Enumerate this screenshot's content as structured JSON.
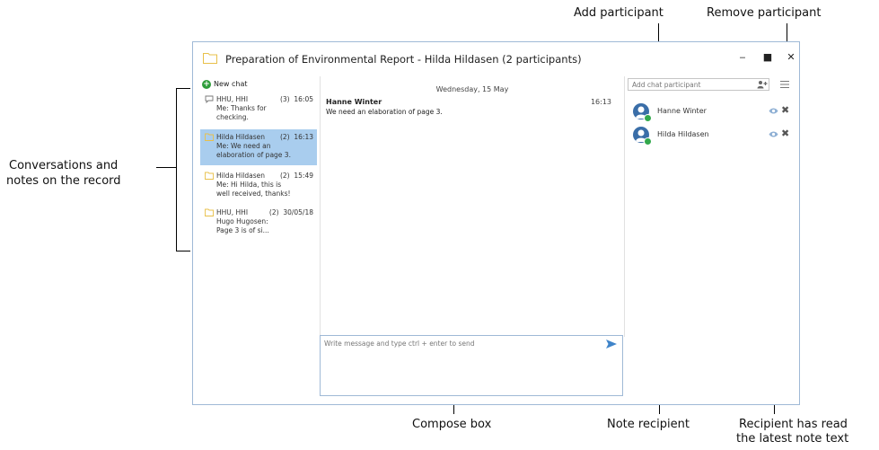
{
  "callouts": {
    "add_participant": "Add participant",
    "remove_participant": "Remove participant",
    "conversations_line1": "Conversations and",
    "conversations_line2": "notes on the record",
    "compose_box": "Compose box",
    "note_recipient": "Note recipient",
    "read_line1": "Recipient has read",
    "read_line2": "the latest note text"
  },
  "window": {
    "title": "Preparation of Environmental Report  - Hilda Hildasen (2 participants)",
    "minimize": "‒",
    "maximize": "■",
    "close": "✕"
  },
  "sidebar": {
    "new_chat": "New chat",
    "conversations": [
      {
        "name": "HHU, HHI",
        "count": "(3)",
        "time": "16:05",
        "line2": "Me: Thanks for",
        "line3": "checking.",
        "icon": "speech-bubble-icon",
        "selected": false
      },
      {
        "name": "Hilda Hildasen",
        "count": "(2)",
        "time": "16:13",
        "line2": "Me: We need an",
        "line3": "elaboration of page 3.",
        "icon": "folder-icon",
        "selected": true
      },
      {
        "name": "Hilda Hildasen",
        "count": "(2)",
        "time": "15:49",
        "line2": "Me: Hi Hilda, this is",
        "line3": "well received, thanks!",
        "icon": "folder-icon",
        "selected": false
      },
      {
        "name": "HHU, HHI",
        "count": "(2)",
        "time": "30/05/18",
        "line2": "Hugo Hugosen:",
        "line3": "Page 3 is of si...",
        "icon": "folder-icon",
        "selected": false
      }
    ]
  },
  "chat": {
    "date_header": "Wednesday, 15 May",
    "message": {
      "sender": "Hanne Winter",
      "time": "16:13",
      "text": "We need an elaboration of page 3."
    },
    "compose_placeholder": "Write message and type ctrl + enter to send"
  },
  "participants": {
    "add_placeholder": "Add chat participant",
    "list": [
      {
        "name": "Hanne Winter"
      },
      {
        "name": "Hilda Hildasen"
      }
    ]
  },
  "colors": {
    "selected_row": "#a9cdee",
    "window_border": "#9fb9d6",
    "presence_green": "#32a84c",
    "avatar_blue": "#3a6ea8",
    "send_arrow": "#3f84c9",
    "folder_yellow": "#e8c04a"
  }
}
